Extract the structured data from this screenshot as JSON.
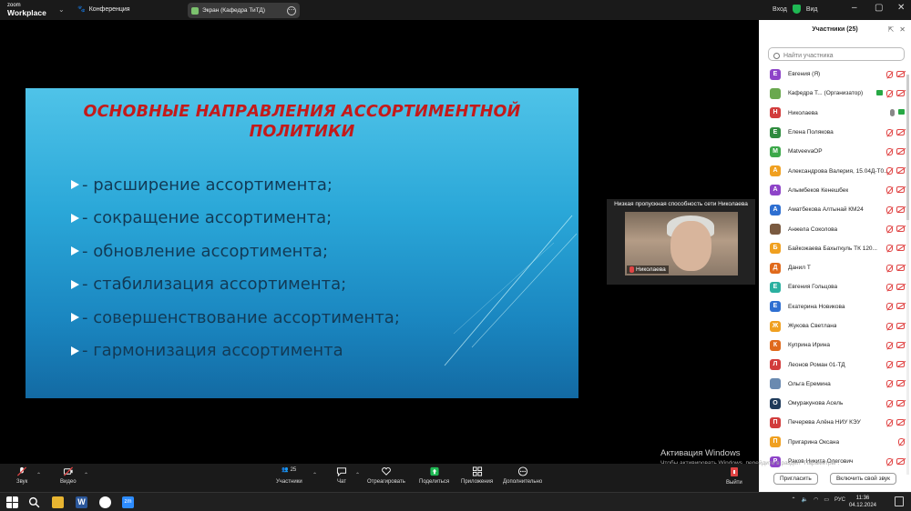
{
  "app": {
    "logo_top": "zoom",
    "logo_bottom": "Workplace",
    "conference_label": "Конференция",
    "screen_share_label": "Экран (Кафедра ТиТД)",
    "signin_label": "Вход",
    "view_label": "Вид"
  },
  "slide": {
    "title_line1": "Основные направления ассортиментной",
    "title_line2": "политики",
    "bullets": [
      "- расширение ассортимента;",
      "- сокращение ассортимента;",
      "- обновление ассортимента;",
      "- стабилизация ассортимента;",
      "- совершенствование ассортимента;",
      "- гармонизация ассортимента"
    ]
  },
  "video": {
    "warning": "Низкая пропускная способность сети Николаева",
    "name": "Николаева"
  },
  "participants": {
    "title": "Участники (25)",
    "search_placeholder": "Найти участника",
    "list": [
      {
        "initial": "Е",
        "name": "Евгения (Я)",
        "color": "#8e44c8"
      },
      {
        "initial": "",
        "name": "Кафедра Т...   (Организатор)",
        "color": "#6aa84f"
      },
      {
        "initial": "Н",
        "name": "Николаева",
        "color": "#d23c3c"
      },
      {
        "initial": "Е",
        "name": "Елена Полякова",
        "color": "#2e8b3e"
      },
      {
        "initial": "M",
        "name": "MatveevaOP",
        "color": "#3ca84a"
      },
      {
        "initial": "А",
        "name": "Александрова Валерия, 15.04Д-Т0...",
        "color": "#f0a020"
      },
      {
        "initial": "А",
        "name": "Алымбеков Кенешбек",
        "color": "#8e44c8"
      },
      {
        "initial": "А",
        "name": "Аматбекова Алтынай КМ24",
        "color": "#2e6fd1"
      },
      {
        "initial": "",
        "name": "Анжела Соколова",
        "color": "#7a5a40"
      },
      {
        "initial": "Б",
        "name": "Байкожаева Бахыткуль ТК 120...",
        "color": "#f0a020"
      },
      {
        "initial": "Д",
        "name": "Данил Т",
        "color": "#e06a1c"
      },
      {
        "initial": "Е",
        "name": "Евгения Гольцова",
        "color": "#2bb0a0"
      },
      {
        "initial": "Е",
        "name": "Екатерина Новикова",
        "color": "#2e6fd1"
      },
      {
        "initial": "Ж",
        "name": "Жукова Светлана",
        "color": "#f0a020"
      },
      {
        "initial": "К",
        "name": "Куприна Ирина",
        "color": "#e06a1c"
      },
      {
        "initial": "Л",
        "name": "Леонов Роман 01-ТД",
        "color": "#d23c3c"
      },
      {
        "initial": "",
        "name": "Ольга Еремина",
        "color": "#6a8ab0"
      },
      {
        "initial": "О",
        "name": "Омуракунова Асель",
        "color": "#1e3a5a"
      },
      {
        "initial": "П",
        "name": "Печерева Алёна НИУ КЭУ",
        "color": "#d23c3c"
      },
      {
        "initial": "П",
        "name": "Пригарина Оксана",
        "color": "#f0a020"
      },
      {
        "initial": "Р",
        "name": "Раков Никита Олегович",
        "color": "#8e44c8"
      }
    ],
    "invite_label": "Пригласить",
    "unmute_label": "Включить свой звук"
  },
  "toolbar": {
    "audio": "Звук",
    "video": "Видео",
    "participants": "Участники",
    "participants_count": "25",
    "chat": "Чат",
    "react": "Отреагировать",
    "share": "Поделиться",
    "apps": "Приложения",
    "more": "Дополнительно",
    "leave": "Выйти"
  },
  "activation": {
    "title": "Активация Windows",
    "subtitle": "Чтобы активировать Windows, перейдите в раздел \"Параметры\"."
  },
  "taskbar": {
    "lang": "РУС",
    "time": "11:36",
    "date": "04.12.2024"
  }
}
